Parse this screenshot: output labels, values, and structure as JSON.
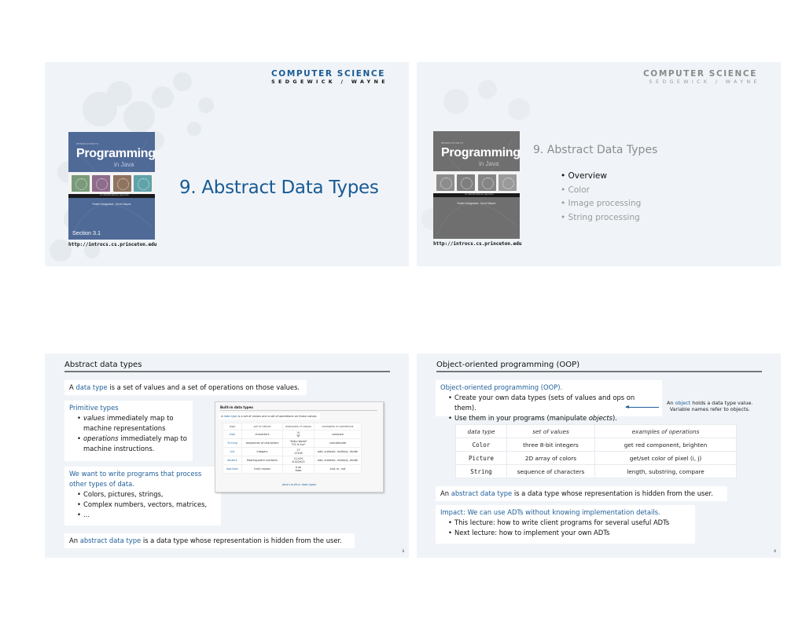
{
  "brand": {
    "title": "COMPUTER SCIENCE",
    "subtitle": "SEDGEWICK / WAYNE"
  },
  "book": {
    "intro": "INTRODUCTION TO",
    "title": "Programming",
    "subtitle": "in Java",
    "tagline": "An Interdisciplinary Approach",
    "authors": "Robert Sedgewick · Kevin Wayne",
    "section": "Section 3.1",
    "url": "http://introcs.cs.princeton.edu",
    "tile_colors": [
      "#7a9a7a",
      "#8e6c8c",
      "#8f735f",
      "#5fa3a8"
    ]
  },
  "slides": [
    {
      "title": "9. Abstract Data Types"
    },
    {
      "title": "9. Abstract Data Types",
      "outline": [
        {
          "label": "Overview",
          "active": true
        },
        {
          "label": "Color",
          "active": false
        },
        {
          "label": "Image processing",
          "active": false
        },
        {
          "label": "String processing",
          "active": false
        }
      ]
    },
    {
      "heading": "Abstract data types",
      "definition": {
        "pre": "A ",
        "term": "data type",
        "post": " is a set of values and a set of operations on those values."
      },
      "primitive": {
        "title": "Primitive types",
        "bullets": [
          {
            "em": "values",
            "text": " immediately map to machine representations"
          },
          {
            "em": "operations",
            "text": " immediately map to machine instructions."
          }
        ]
      },
      "other": {
        "title": "We want to write programs that process other types of data.",
        "bullets": [
          "Colors, pictures, strings,",
          "Complex numbers, vectors, matrices,",
          "..."
        ]
      },
      "adt": {
        "pre": "An ",
        "term": "abstract data type",
        "post": " is a data type whose representation is hidden from the user."
      },
      "builtin": {
        "heading": "Built-in data types",
        "desc_pre": "A ",
        "desc_term": "data type",
        "desc_post": " is a set of values and a set of operations on those values.",
        "columns": [
          "type",
          "set of values",
          "examples of values",
          "examples of operations"
        ],
        "rows": [
          [
            "char",
            "characters",
            "'A'\n'@'",
            "compare"
          ],
          [
            "String",
            "sequences of characters",
            "\"Hello World\"\n\"CS is fun\"",
            "concatenate"
          ],
          [
            "int",
            "integers",
            "17\n12345",
            "add, subtract, multiply, divide"
          ],
          [
            "double",
            "floating-point numbers",
            "3.1415\n6.022e23",
            "add, subtract, multiply, divide"
          ],
          [
            "boolean",
            "truth values",
            "true\nfalse",
            "and, or, not"
          ]
        ],
        "caption": "Java's built-in data types"
      },
      "page": "3"
    },
    {
      "heading": "Object-oriented programming (OOP)",
      "oop": {
        "title": "Object-oriented programming (OOP).",
        "bullets": [
          {
            "text": "Create your own data types (sets of values and ops on them).",
            "em": ""
          },
          {
            "text": "Use them in your programs (manipulate ",
            "em": "objects",
            "post": ")."
          }
        ]
      },
      "annotation": {
        "pre": "An ",
        "term": "object",
        "line1_post": " holds a data type value.",
        "line2": "Variable names refer to objects."
      },
      "table": {
        "columns": [
          "data type",
          "set of values",
          "examples of operations"
        ],
        "rows": [
          [
            "Color",
            "three 8-bit integers",
            "get red component, brighten"
          ],
          [
            "Picture",
            "2D array of colors",
            "get/set color of pixel (i, j)"
          ],
          [
            "String",
            "sequence of characters",
            "length, substring, compare"
          ]
        ]
      },
      "adt": {
        "pre": "An ",
        "term": "abstract data type",
        "post": " is a data type whose representation is hidden from the user."
      },
      "impact": {
        "title": "Impact: We can use ADTs without knowing implementation details.",
        "bullets": [
          "This lecture: how to write client programs for several useful ADTs",
          "Next lecture: how to implement your own ADTs"
        ]
      },
      "page": "4"
    }
  ]
}
